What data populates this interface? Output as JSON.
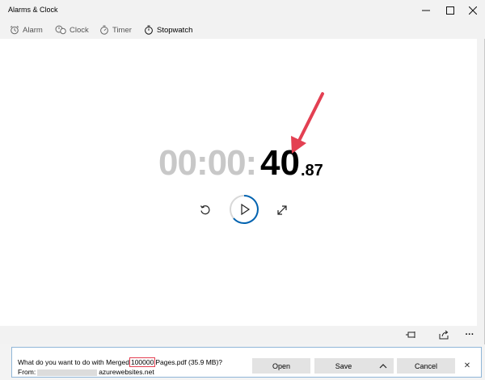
{
  "window": {
    "title": "Alarms & Clock",
    "controls": {
      "minimize": "—",
      "maximize": "☐",
      "close": "✕"
    }
  },
  "tabs": [
    {
      "label": "Alarm",
      "icon": "alarm-icon"
    },
    {
      "label": "Clock",
      "icon": "clock-icon"
    },
    {
      "label": "Timer",
      "icon": "timer-icon"
    },
    {
      "label": "Stopwatch",
      "icon": "stopwatch-icon",
      "active": true
    }
  ],
  "stopwatch": {
    "time_grey": "00:00:",
    "time_seconds": "40",
    "time_fraction": ".87",
    "controls": [
      "reset-icon",
      "play-icon",
      "expand-icon"
    ]
  },
  "bottom_bar": {
    "icons": [
      "pin-icon",
      "share-icon",
      "more-icon"
    ],
    "more_label": "···"
  },
  "download_bar": {
    "prompt_prefix": "What do you want to do with Merged",
    "highlighted_count": "100000",
    "prompt_suffix": "Pages.pdf (35.9 MB)?",
    "from_label": "From:",
    "source_domain": "azurewebsites.net",
    "open_label": "Open",
    "save_label": "Save",
    "cancel_label": "Cancel",
    "close_glyph": "✕"
  },
  "colors": {
    "accent": "#0063b1",
    "annotation": "#e34052",
    "time_grey": "#c8c8c8"
  }
}
